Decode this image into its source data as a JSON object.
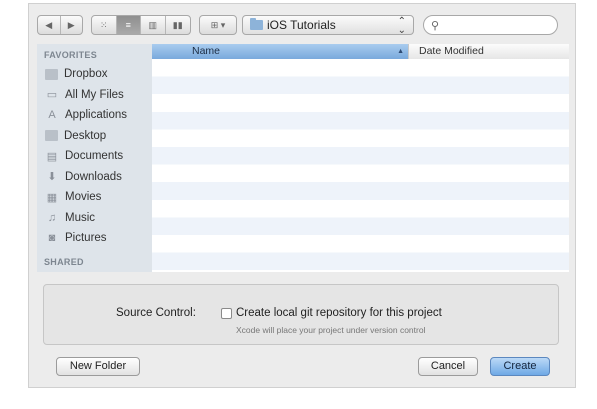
{
  "toolbar": {
    "nav": {
      "back_glyph": "◀",
      "forward_glyph": "▶"
    },
    "view_buttons": [
      {
        "name": "icon-view",
        "glyph": "⁙",
        "selected": false
      },
      {
        "name": "list-view",
        "glyph": "≡",
        "selected": true
      },
      {
        "name": "column-view",
        "glyph": "▥",
        "selected": false
      },
      {
        "name": "coverflow-view",
        "glyph": "▮▮",
        "selected": false
      }
    ],
    "arrange_glyph": "⊞ ▾",
    "location": {
      "label": "iOS Tutorials",
      "chevron": "⌃⌄"
    },
    "search": {
      "placeholder": "",
      "icon": "search-icon",
      "glyph": "⚲"
    }
  },
  "sidebar": {
    "favorites_heading": "FAVORITES",
    "items": [
      {
        "name": "dropbox",
        "label": "Dropbox",
        "icon": "folder-icon",
        "glyph": ""
      },
      {
        "name": "all-my-files",
        "label": "All My Files",
        "icon": "files-icon",
        "glyph": "▭"
      },
      {
        "name": "applications",
        "label": "Applications",
        "icon": "applications-icon",
        "glyph": "A"
      },
      {
        "name": "desktop",
        "label": "Desktop",
        "icon": "desktop-icon",
        "glyph": ""
      },
      {
        "name": "documents",
        "label": "Documents",
        "icon": "documents-icon",
        "glyph": "▤"
      },
      {
        "name": "downloads",
        "label": "Downloads",
        "icon": "downloads-icon",
        "glyph": "⬇"
      },
      {
        "name": "movies",
        "label": "Movies",
        "icon": "movies-icon",
        "glyph": "▦"
      },
      {
        "name": "music",
        "label": "Music",
        "icon": "music-icon",
        "glyph": "♫"
      },
      {
        "name": "pictures",
        "label": "Pictures",
        "icon": "pictures-icon",
        "glyph": "◙"
      }
    ],
    "shared_heading": "SHARED"
  },
  "file_list": {
    "columns": [
      {
        "label": "Name",
        "sorted": true,
        "sort_glyph": "▲"
      },
      {
        "label": "Date Modified"
      }
    ],
    "rows": []
  },
  "options": {
    "source_control_label": "Source Control:",
    "checkbox_label": "Create local git repository for this project",
    "checkbox_checked": false,
    "hint": "Xcode will place your project under version control"
  },
  "buttons": {
    "new_folder": "New Folder",
    "cancel": "Cancel",
    "create": "Create"
  },
  "colors": {
    "dialog_bg": "#ececec",
    "sidebar_bg": "#dee4ea",
    "header_selected": "#79a9dc",
    "primary_button": "#6fa9e6"
  }
}
